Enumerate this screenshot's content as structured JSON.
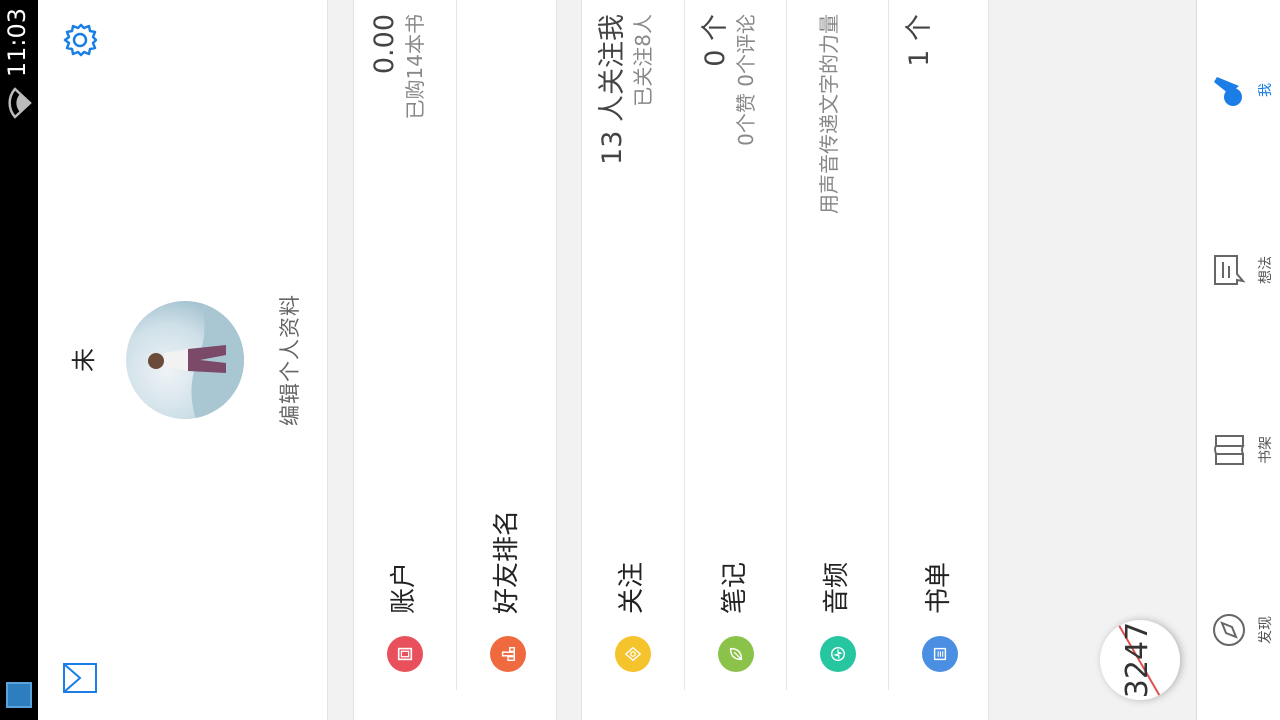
{
  "status": {
    "time": "11:03"
  },
  "profile": {
    "name": "未",
    "edit_label": "编辑个人资料"
  },
  "account_card": [
    {
      "label": "账户",
      "value": "0.00",
      "sub": "已购14本书",
      "color": "#e8505b"
    },
    {
      "label": "好友排名",
      "value": "",
      "sub": "",
      "color": "#f06a3f"
    }
  ],
  "social_card": [
    {
      "label": "关注",
      "value": "13 人关注我",
      "sub": "已关注8人",
      "color": "#f5c32c"
    },
    {
      "label": "笔记",
      "value": "0 个",
      "sub": "0个赞 0个评论",
      "color": "#8bc34a"
    },
    {
      "label": "音频",
      "value": "",
      "sub": "用声音传递文字的力量",
      "color": "#26c6a0"
    },
    {
      "label": "书单",
      "value": "1 个",
      "sub": "",
      "color": "#4a8fe2"
    }
  ],
  "tabs": [
    {
      "label": "发现",
      "active": false
    },
    {
      "label": "书架",
      "active": false
    },
    {
      "label": "想法",
      "active": false
    },
    {
      "label": "我",
      "active": true
    }
  ],
  "float_badge": {
    "text": "3247"
  },
  "colors": {
    "accent": "#1a7ee6",
    "background": "#f2f2f2"
  }
}
